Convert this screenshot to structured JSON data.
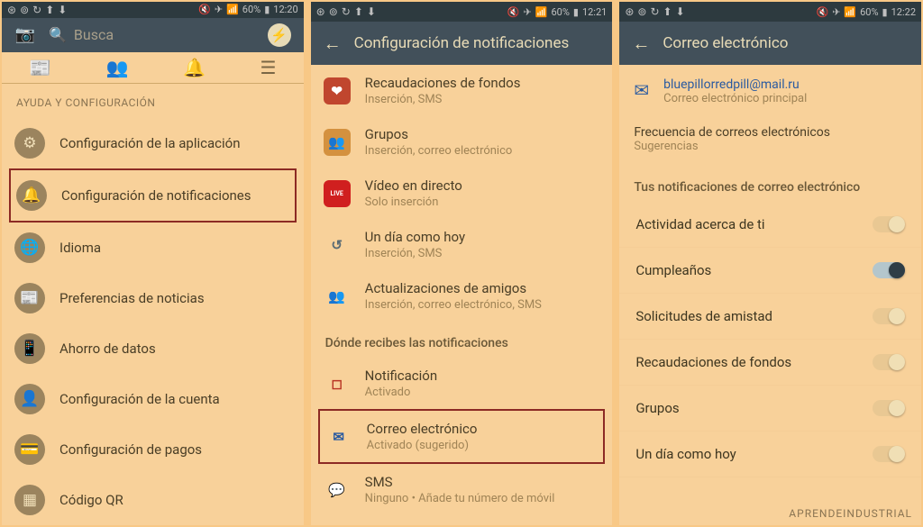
{
  "watermark": "APRENDEINDUSTRIAL",
  "phone1": {
    "time": "12:20",
    "battery": "60%",
    "search_placeholder": "Busca",
    "section": "AYUDA Y CONFIGURACIÓN",
    "items": [
      {
        "icon": "⚙",
        "label": "Configuración de la aplicación"
      },
      {
        "icon": "🔔",
        "label": "Configuración de notificaciones",
        "highlight": true
      },
      {
        "icon": "🌐",
        "label": "Idioma"
      },
      {
        "icon": "📰",
        "label": "Preferencias de noticias"
      },
      {
        "icon": "📱",
        "label": "Ahorro de datos"
      },
      {
        "icon": "👤",
        "label": "Configuración de la cuenta"
      },
      {
        "icon": "💳",
        "label": "Configuración de pagos"
      },
      {
        "icon": "▦",
        "label": "Código QR"
      }
    ]
  },
  "phone2": {
    "time": "12:21",
    "battery": "60%",
    "title": "Configuración de notificaciones",
    "itemsA": [
      {
        "bg": "#c0462e",
        "icon": "❤",
        "label": "Recaudaciones de fondos",
        "sub": "Inserción, SMS"
      },
      {
        "bg": "#d4913f",
        "icon": "👥",
        "label": "Grupos",
        "sub": "Inserción, correo electrónico"
      },
      {
        "bg": "#d01f1f",
        "icon": "LIVE",
        "fs": "7px",
        "label": "Vídeo en directo",
        "sub": "Solo inserción"
      },
      {
        "bg": "transparent",
        "icon": "↺",
        "label": "Un día como hoy",
        "sub": "Inserción, SMS",
        "txt": "#5a6b74"
      },
      {
        "bg": "transparent",
        "icon": "👥",
        "label": "Actualizaciones de amigos",
        "sub": "Inserción, correo electrónico, SMS",
        "txt": "#3c4d55"
      }
    ],
    "section2": "Dónde recibes las notificaciones",
    "itemsB": [
      {
        "bg": "transparent",
        "icon": "◻",
        "txt": "#b93524",
        "label": "Notificación",
        "sub": "Activado"
      },
      {
        "bg": "transparent",
        "icon": "✉",
        "txt": "#2a5aa0",
        "label": "Correo electrónico",
        "sub": "Activado (sugerido)",
        "highlight": true
      },
      {
        "bg": "transparent",
        "icon": "💬",
        "txt": "#3a7a3a",
        "label": "SMS",
        "sub": "Ninguno • Añade tu número de móvil",
        "subred": true
      }
    ]
  },
  "phone3": {
    "time": "12:22",
    "battery": "60%",
    "title": "Correo electrónico",
    "email": "bluepillorredpill@mail.ru",
    "email_sub": "Correo electrónico principal",
    "freq_label": "Frecuencia de correos electrónicos",
    "freq_val": "Sugerencias",
    "section": "Tus notificaciones de correo electrónico",
    "toggles": [
      {
        "label": "Actividad acerca de ti",
        "on": false
      },
      {
        "label": "Cumpleaños",
        "on": true
      },
      {
        "label": "Solicitudes de amistad",
        "on": false
      },
      {
        "label": "Recaudaciones de fondos",
        "on": false
      },
      {
        "label": "Grupos",
        "on": false
      },
      {
        "label": "Un día como hoy",
        "on": false
      }
    ]
  }
}
